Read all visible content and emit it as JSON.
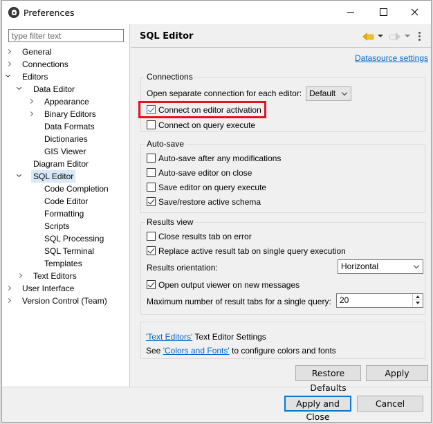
{
  "window": {
    "title": "Preferences"
  },
  "sidebar": {
    "filter_placeholder": "type filter text",
    "items": [
      {
        "label": "General",
        "level": 0,
        "twisty": "closed"
      },
      {
        "label": "Connections",
        "level": 0,
        "twisty": "closed"
      },
      {
        "label": "Editors",
        "level": 0,
        "twisty": "open"
      },
      {
        "label": "Data Editor",
        "level": 1,
        "twisty": "open"
      },
      {
        "label": "Appearance",
        "level": 2,
        "twisty": "closed"
      },
      {
        "label": "Binary Editors",
        "level": 2,
        "twisty": "closed"
      },
      {
        "label": "Data Formats",
        "level": 2,
        "twisty": "none"
      },
      {
        "label": "Dictionaries",
        "level": 2,
        "twisty": "none"
      },
      {
        "label": "GIS Viewer",
        "level": 2,
        "twisty": "none"
      },
      {
        "label": "Diagram Editor",
        "level": 1,
        "twisty": "none"
      },
      {
        "label": "SQL Editor",
        "level": 1,
        "twisty": "open",
        "selected": true
      },
      {
        "label": "Code Completion",
        "level": 2,
        "twisty": "none"
      },
      {
        "label": "Code Editor",
        "level": 2,
        "twisty": "none"
      },
      {
        "label": "Formatting",
        "level": 2,
        "twisty": "none"
      },
      {
        "label": "Scripts",
        "level": 2,
        "twisty": "none"
      },
      {
        "label": "SQL Processing",
        "level": 2,
        "twisty": "none"
      },
      {
        "label": "SQL Terminal",
        "level": 2,
        "twisty": "none"
      },
      {
        "label": "Templates",
        "level": 2,
        "twisty": "none"
      },
      {
        "label": "Text Editors",
        "level": 1,
        "twisty": "closed"
      },
      {
        "label": "User Interface",
        "level": 0,
        "twisty": "closed"
      },
      {
        "label": "Version Control (Team)",
        "level": 0,
        "twisty": "closed"
      }
    ]
  },
  "main": {
    "title": "SQL Editor",
    "datasource_link": "Datasource settings",
    "connections": {
      "label": "Connections",
      "open_separate_label": "Open separate connection for each editor:",
      "open_separate_value": "Default",
      "connect_on_activation": {
        "label": "Connect on editor activation",
        "checked": true
      },
      "connect_on_execute": {
        "label": "Connect on query execute",
        "checked": false
      }
    },
    "autosave": {
      "label": "Auto-save",
      "after_modifications": {
        "label": "Auto-save after any modifications",
        "checked": false
      },
      "on_close": {
        "label": "Auto-save editor on close",
        "checked": false
      },
      "on_execute": {
        "label": "Save editor on query execute",
        "checked": false
      },
      "active_schema": {
        "label": "Save/restore active schema",
        "checked": true
      }
    },
    "results": {
      "label": "Results view",
      "close_on_error": {
        "label": "Close results tab on error",
        "checked": false
      },
      "replace_active": {
        "label": "Replace active result tab on single query execution",
        "checked": true
      },
      "orientation_label": "Results orientation:",
      "orientation_value": "Horizontal",
      "open_output": {
        "label": "Open output viewer on new messages",
        "checked": true
      },
      "max_tabs_label": "Maximum number of result tabs for a single query:",
      "max_tabs_value": "20"
    },
    "info": {
      "text_editors_link": "'Text Editors'",
      "text_editors_suffix": "Text Editor Settings",
      "see_prefix": "See",
      "colors_fonts_link": "'Colors and Fonts'",
      "colors_fonts_suffix": "to configure colors and fonts"
    },
    "restore_defaults": "Restore Defaults",
    "apply": "Apply"
  },
  "footer": {
    "apply_close": "Apply and Close",
    "cancel": "Cancel"
  },
  "colors": {
    "highlight_border": "#e81123",
    "link": "#0066cc",
    "default_button_border": "#0078d7",
    "selection": "#d9e9f9"
  }
}
